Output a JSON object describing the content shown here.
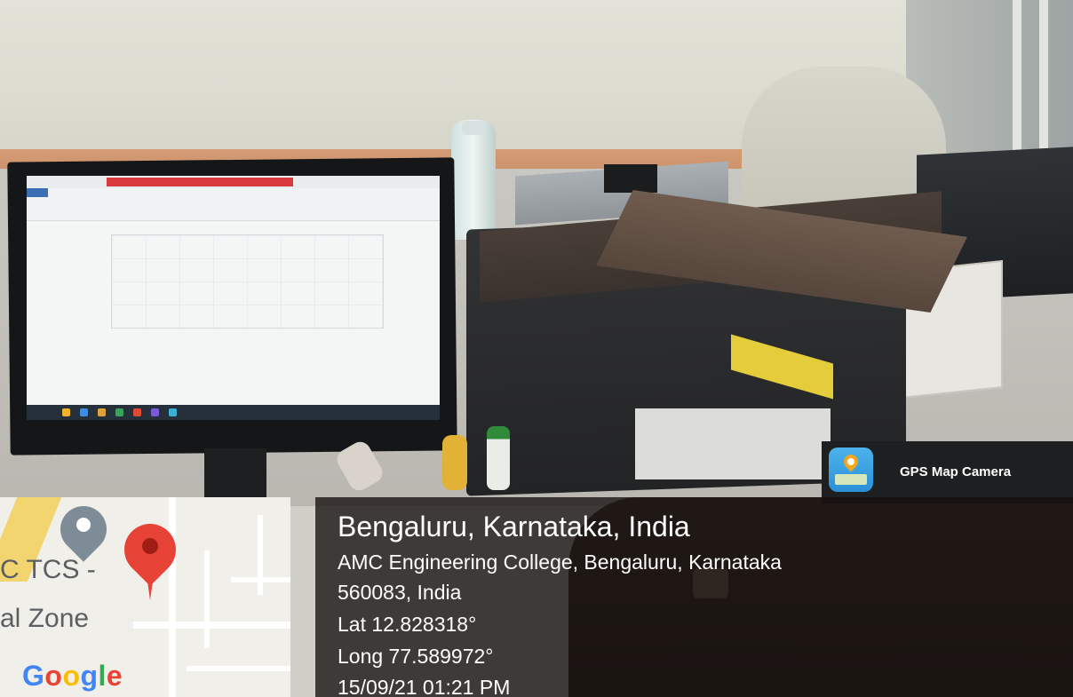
{
  "badge": {
    "app_name": "GPS Map Camera",
    "icon": "gps-map-camera-app-icon"
  },
  "location": {
    "title": "Bengaluru, Karnataka, India",
    "address_line1": "AMC Engineering College, Bengaluru, Karnataka",
    "address_line2": "560083, India",
    "latitude": "Lat 12.828318°",
    "longitude": "Long 77.589972°",
    "timestamp": "15/09/21 01:21 PM"
  },
  "map": {
    "label_line1": "C TCS -",
    "label_line2": "al Zone",
    "logo_letters": [
      "G",
      "o",
      "o",
      "g",
      "l",
      "e"
    ],
    "logo_colors": [
      "#4285F4",
      "#EA4335",
      "#FBBC05",
      "#4285F4",
      "#34A853",
      "#EA4335"
    ],
    "pins": [
      "grey-location-pin-icon",
      "red-location-pin-icon"
    ]
  },
  "colors": {
    "pin_red": "#e64236",
    "pin_grey": "#7e8c97",
    "overlay_dark": "#1e1f21"
  }
}
